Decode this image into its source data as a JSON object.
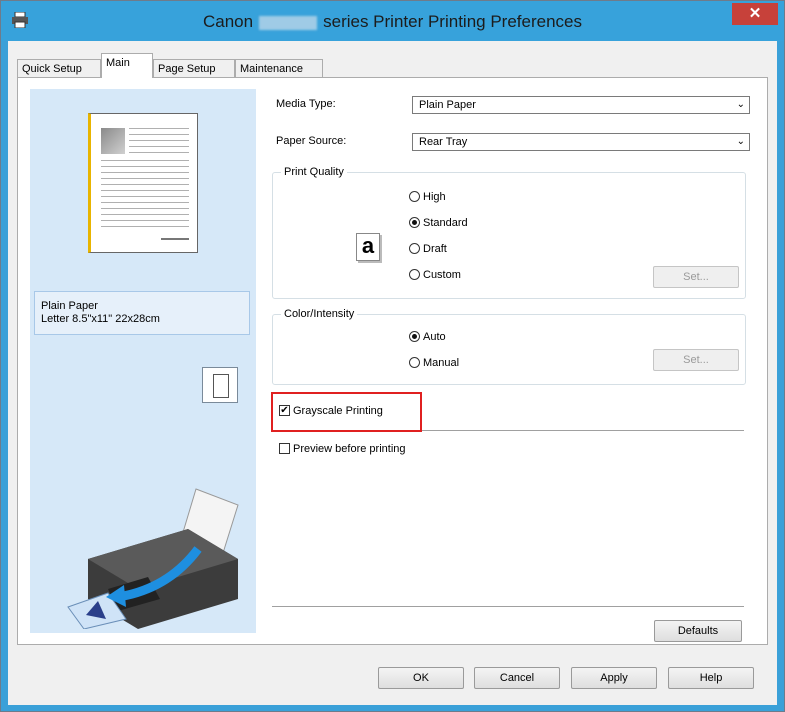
{
  "window": {
    "title_left": "Canon",
    "title_right": "series Printer Printing Preferences",
    "close_glyph": "✕"
  },
  "tabs": [
    {
      "label": "Quick Setup",
      "active": false
    },
    {
      "label": "Main",
      "active": true
    },
    {
      "label": "Page Setup",
      "active": false
    },
    {
      "label": "Maintenance",
      "active": false
    }
  ],
  "preview": {
    "media_line1": "Plain Paper",
    "media_line2": "Letter 8.5\"x11\" 22x28cm"
  },
  "main": {
    "media_type_label": "Media Type:",
    "media_type_value": "Plain Paper",
    "paper_source_label": "Paper Source:",
    "paper_source_value": "Rear Tray",
    "print_quality": {
      "title": "Print Quality",
      "icon_glyph": "a",
      "options": [
        "High",
        "Standard",
        "Draft",
        "Custom"
      ],
      "selected": "Standard",
      "set_label": "Set..."
    },
    "color_intensity": {
      "title": "Color/Intensity",
      "options": [
        "Auto",
        "Manual"
      ],
      "selected": "Auto",
      "set_label": "Set..."
    },
    "grayscale_label": "Grayscale Printing",
    "grayscale_checked": true,
    "preview_label": "Preview before printing",
    "preview_checked": false,
    "defaults_label": "Defaults"
  },
  "footer": {
    "ok": "OK",
    "cancel": "Cancel",
    "apply": "Apply",
    "help": "Help"
  },
  "colors": {
    "titlebar": "#37a2db",
    "close": "#c7413a",
    "preview_pane": "#d6e8f8",
    "highlight": "#e02020"
  }
}
